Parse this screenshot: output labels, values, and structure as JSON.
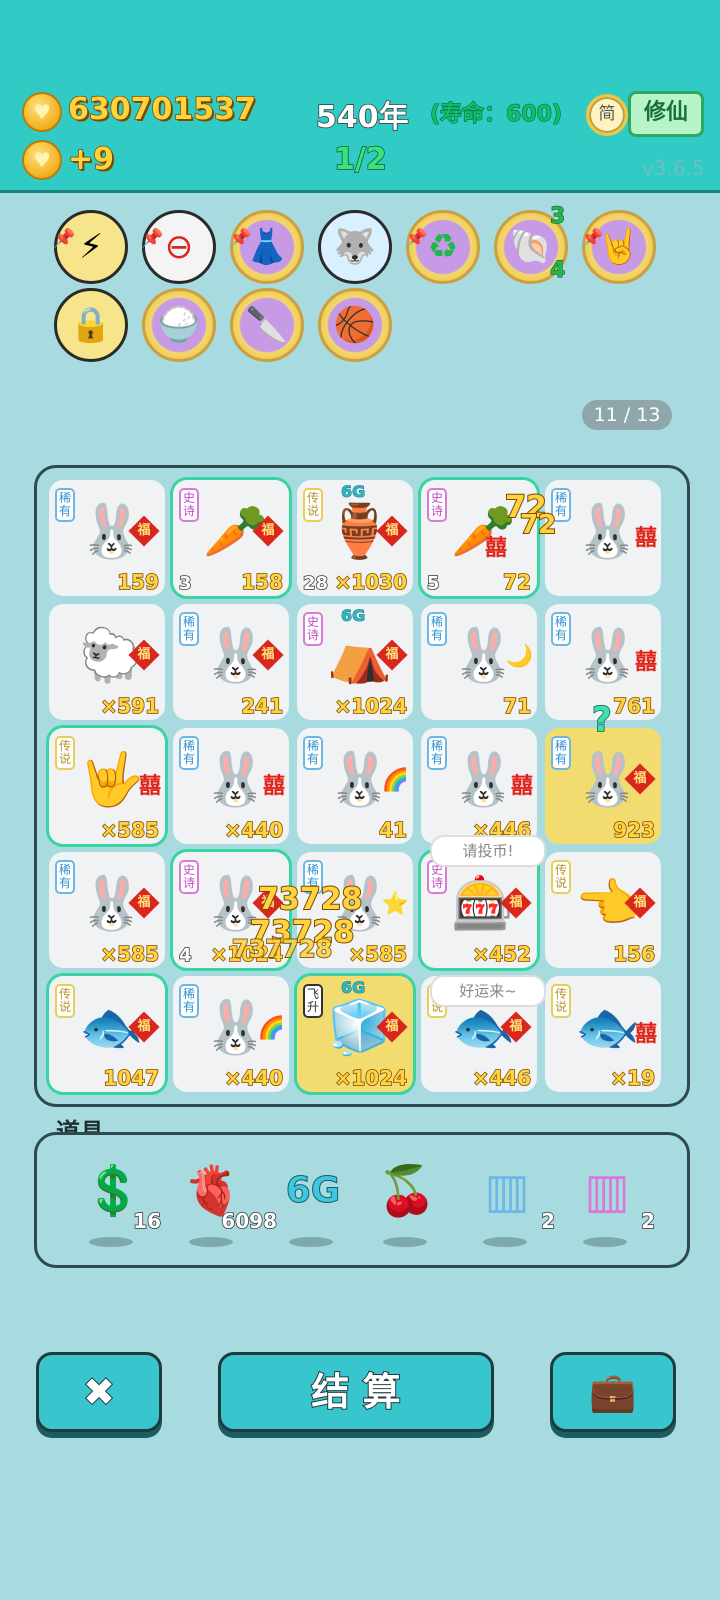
{
  "header": {
    "gold": "630701537",
    "income": "+9",
    "year": "540年",
    "lifespan": "(寿命：600)",
    "round": "1/2",
    "lang_button": "简",
    "mode_button": "修仙",
    "version": "v3.6.5"
  },
  "relics": [
    {
      "icon": "⚡",
      "name": "lightning"
    },
    {
      "icon": "⊖",
      "name": "minus"
    },
    {
      "icon": "👗",
      "name": "skirt"
    },
    {
      "icon": "🐺",
      "name": "husky"
    },
    {
      "icon": "♻",
      "name": "recycle"
    },
    {
      "icon": "🐚",
      "name": "shell",
      "top": "3",
      "bottom": "4"
    },
    {
      "icon": "🤘",
      "name": "rock-hand"
    },
    {
      "icon": "🔒",
      "name": "safe"
    },
    {
      "icon": "🍚",
      "name": "rice-bowls"
    },
    {
      "icon": "🔪",
      "name": "cleaver"
    },
    {
      "icon": "🏀",
      "name": "basketballs"
    }
  ],
  "page_indicator": "11 / 13",
  "board": [
    {
      "tag": "稀有",
      "icon": "🐰",
      "badge": "福",
      "count": "159"
    },
    {
      "tag": "史诗",
      "icon": "🥕",
      "badge": "福",
      "count": "158",
      "left": "3"
    },
    {
      "tag": "传说",
      "icon": "🏺",
      "sixg": "6G",
      "badge": "福",
      "count": "×1030",
      "left": "28"
    },
    {
      "tag": "史诗",
      "icon": "🥕",
      "badge": "囍",
      "count": "72",
      "left": "5"
    },
    {
      "tag": "稀有",
      "icon": "🐰",
      "badge": "囍",
      "count": ""
    },
    {
      "tag": "",
      "icon": "🐑",
      "badge": "福",
      "count": "×591"
    },
    {
      "tag": "稀有",
      "icon": "🐰",
      "badge": "福",
      "count": "241"
    },
    {
      "tag": "史诗",
      "icon": "⛺",
      "sixg": "6G",
      "badge": "福",
      "count": "×1024"
    },
    {
      "tag": "稀有",
      "icon": "🐰",
      "badge": "🌙",
      "count": "71"
    },
    {
      "tag": "稀有",
      "icon": "🐰",
      "badge": "囍",
      "count": "761"
    },
    {
      "tag": "传说",
      "icon": "🤟",
      "badge": "囍",
      "count": "×585"
    },
    {
      "tag": "稀有",
      "icon": "🐰",
      "badge": "囍",
      "count": "×440"
    },
    {
      "tag": "稀有",
      "icon": "🐰",
      "badge": "🌈",
      "count": "41"
    },
    {
      "tag": "稀有",
      "icon": "🐰",
      "badge": "囍",
      "count": "×446"
    },
    {
      "tag": "稀有",
      "icon": "🐰",
      "badge": "福",
      "count": "923"
    },
    {
      "tag": "稀有",
      "icon": "🐰",
      "badge": "福",
      "count": "×585"
    },
    {
      "tag": "史诗",
      "icon": "🐰",
      "badge": "福",
      "count": "×1024",
      "left": "4"
    },
    {
      "tag": "稀有",
      "icon": "🐰",
      "badge": "⭐",
      "count": "×585"
    },
    {
      "tag": "史诗",
      "icon": "🎰",
      "badge": "福",
      "count": "×452"
    },
    {
      "tag": "传说",
      "icon": "👈",
      "badge": "福",
      "count": "156"
    },
    {
      "tag": "传说",
      "icon": "🐟",
      "badge": "福",
      "count": "1047"
    },
    {
      "tag": "稀有",
      "icon": "🐰",
      "badge": "🌈",
      "count": "×440"
    },
    {
      "tag": "飞升",
      "icon": "🧊",
      "sixg": "6G",
      "badge": "福",
      "count": "×1024"
    },
    {
      "tag": "传说",
      "icon": "🐟",
      "badge": "福",
      "count": "×446"
    },
    {
      "tag": "传说",
      "icon": "🐟",
      "badge": "囍",
      "count": "×19"
    }
  ],
  "bubbles": {
    "b1": "请投币!",
    "b2": "好运来~"
  },
  "floats": {
    "f1": "72",
    "f2": "72",
    "f3": "73728",
    "f4": "73728",
    "f5": "737728"
  },
  "question_mark": "?",
  "items_title": "道具",
  "items": [
    {
      "icon": "💲",
      "count": "16"
    },
    {
      "icon": "🫀",
      "count": "6098"
    },
    {
      "icon": "6G",
      "count": ""
    },
    {
      "icon": "🍒",
      "count": ""
    },
    {
      "icon": "▥",
      "count": "2"
    },
    {
      "icon": "▥",
      "count": "2"
    }
  ],
  "buttons": {
    "cancel": "✖",
    "settle": "结 算",
    "bag": "💼"
  },
  "colors": {
    "topbar": "#30cbc4",
    "background": "#a8dbe0",
    "gold_text": "#ffd23e"
  }
}
